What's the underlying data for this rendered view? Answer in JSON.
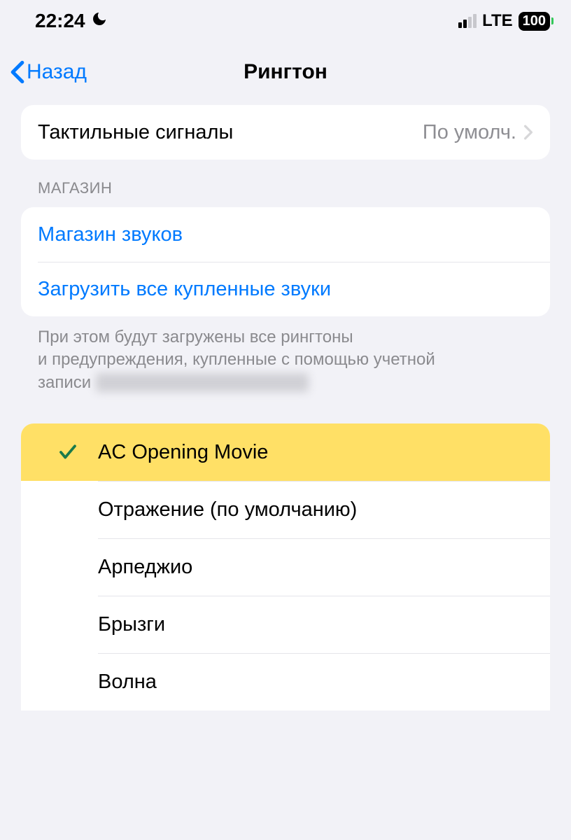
{
  "status": {
    "time": "22:24",
    "network": "LTE",
    "battery": "100"
  },
  "nav": {
    "back": "Назад",
    "title": "Рингтон"
  },
  "haptic": {
    "label": "Тактильные сигналы",
    "value": "По умолч."
  },
  "store": {
    "header": "МАГАЗИН",
    "sound_store": "Магазин звуков",
    "download_all": "Загрузить все купленные звуки",
    "footer_line1": "При этом будут загружены все рингтоны",
    "footer_line2": "и предупреждения, купленные с помощью учетной",
    "footer_line3_prefix": "записи ",
    "footer_line3_redacted": "redacted email address here"
  },
  "ringtones": [
    {
      "name": "AC Opening Movie",
      "selected": true,
      "highlighted": true
    },
    {
      "name": "Отражение (по умолчанию)",
      "selected": false,
      "highlighted": false
    },
    {
      "name": "Арпеджио",
      "selected": false,
      "highlighted": false
    },
    {
      "name": "Брызги",
      "selected": false,
      "highlighted": false
    },
    {
      "name": "Волна",
      "selected": false,
      "highlighted": false
    }
  ]
}
